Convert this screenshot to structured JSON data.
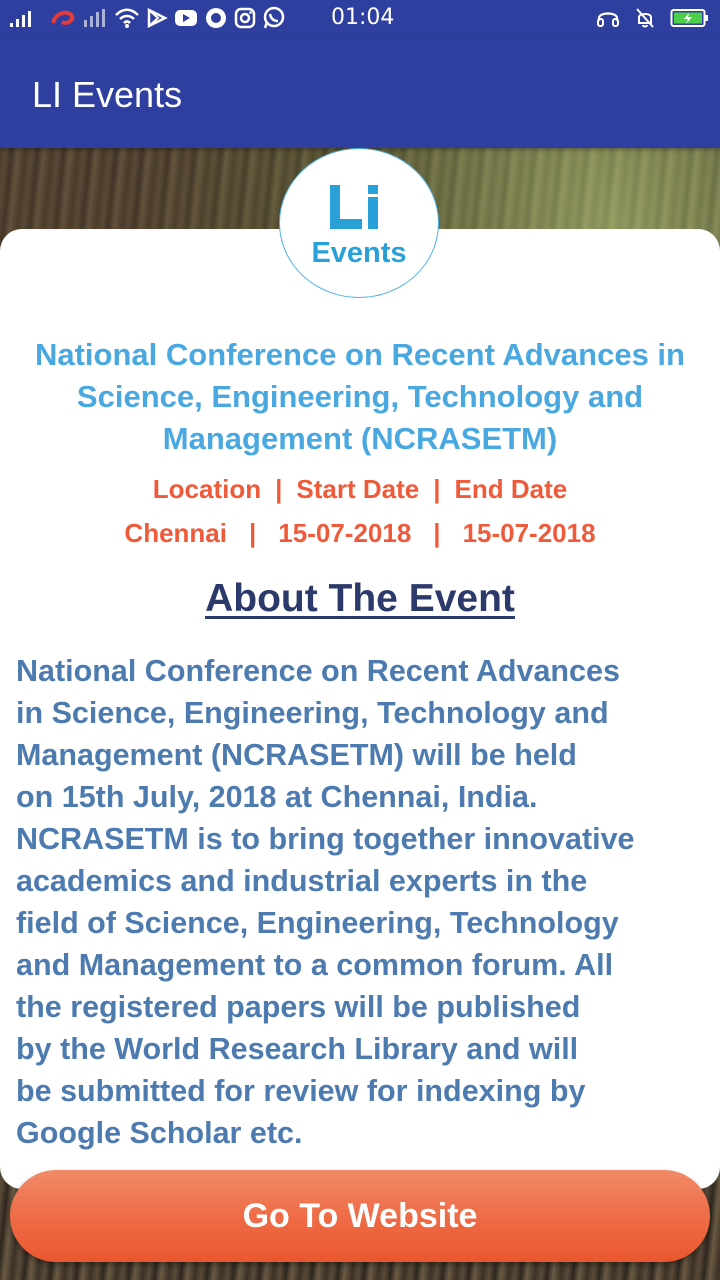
{
  "status_bar": {
    "time": "01:04",
    "left_icons": [
      "signal-icon",
      "airtel-icon",
      "signal-icon",
      "wifi-icon",
      "play-store-icon",
      "youtube-icon",
      "record-icon",
      "instagram-icon",
      "whatsapp-icon"
    ],
    "right_icons": [
      "headset-icon",
      "mute-icon",
      "battery-charging-icon"
    ],
    "accent_color": "#2f3f9f"
  },
  "app_bar": {
    "title": "LI Events"
  },
  "logo": {
    "mark": "LI",
    "text": "Events",
    "color": "#2aa0d8"
  },
  "event": {
    "title": "National Conference on Recent Advances in Science, Engineering, Technology and Management (NCRASETM)",
    "labels": {
      "location": "Location",
      "start_date": "Start Date",
      "end_date": "End Date",
      "separator": "|"
    },
    "values": {
      "location": "Chennai",
      "start_date": "15-07-2018",
      "end_date": "15-07-2018"
    }
  },
  "about": {
    "heading": "About The Event",
    "lines": [
      "National Conference on Recent Advances",
      "in Science, Engineering, Technology and",
      "Management (NCRASETM) will be held",
      "on 15th July, 2018 at Chennai, India.",
      "NCRASETM is to bring together innovative",
      "academics and industrial experts in the",
      "field of Science, Engineering, Technology",
      "and Management to a common forum. All",
      "the registered papers will be published",
      "by the World Research Library and will",
      "be submitted for review for indexing by",
      "Google Scholar etc."
    ]
  },
  "cta": {
    "label": "Go To Website",
    "color": "#ee6a44"
  }
}
